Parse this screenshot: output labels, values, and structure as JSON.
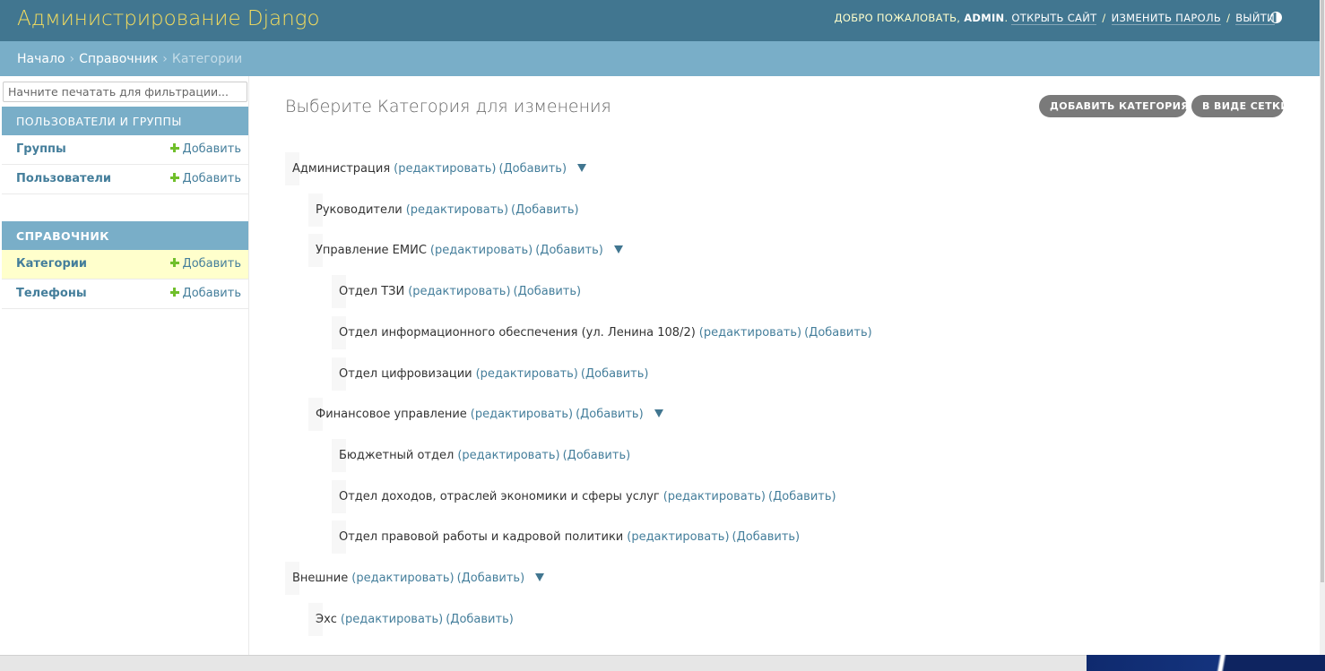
{
  "header": {
    "site_name": "Администрирование Django",
    "welcome": "Добро пожаловать,",
    "username": "admin",
    "view_site": "Открыть сайт",
    "change_password": "Изменить пароль",
    "logout": "Выйти",
    "theme_toggle_icon": "half-circle-icon"
  },
  "breadcrumbs": [
    "Начало",
    "Справочник",
    "Категории"
  ],
  "sidebar": {
    "filter_placeholder": "Начните печатать для фильтрации...",
    "modules": [
      {
        "caption": "Пользователи и группы",
        "models": [
          {
            "name": "Группы",
            "add": "Добавить"
          },
          {
            "name": "Пользователи",
            "add": "Добавить"
          }
        ]
      },
      {
        "caption": "Справочник",
        "models": [
          {
            "name": "Категории",
            "add": "Добавить",
            "current": true
          },
          {
            "name": "Телефоны",
            "add": "Добавить"
          }
        ]
      }
    ]
  },
  "content": {
    "title": "Выберите Категория для изменения",
    "tools": {
      "add": "Добавить Категория",
      "grid": "В виде сетки"
    },
    "edit_label": "(редактировать)",
    "add_label": "(Добавить)",
    "tree": [
      {
        "name": "Администрация",
        "level": 0,
        "expandable": true
      },
      {
        "name": "Руководители",
        "level": 1,
        "expandable": false
      },
      {
        "name": "Управление ЕМИС",
        "level": 1,
        "expandable": true
      },
      {
        "name": "Отдел ТЗИ",
        "level": 2,
        "expandable": false
      },
      {
        "name": "Отдел информационного обеспечения (ул. Ленина 108/2)",
        "level": 2,
        "expandable": false
      },
      {
        "name": "Отдел цифровизации",
        "level": 2,
        "expandable": false
      },
      {
        "name": "Финансовое управление",
        "level": 1,
        "expandable": true
      },
      {
        "name": "Бюджетный отдел",
        "level": 2,
        "expandable": false
      },
      {
        "name": "Отдел доходов, отраслей экономики и сферы услуг",
        "level": 2,
        "expandable": false
      },
      {
        "name": "Отдел правовой работы и кадровой политики",
        "level": 2,
        "expandable": false
      },
      {
        "name": "Внешние",
        "level": 0,
        "expandable": true
      },
      {
        "name": "Эхс",
        "level": 1,
        "expandable": false
      }
    ]
  },
  "colors": {
    "header_bg": "#417690",
    "breadcrumbs_bg": "#79aec8",
    "link": "#447e9b",
    "branding": "#f5dd5d",
    "add_green": "#70bf2b",
    "current_row": "#ffffcc"
  }
}
